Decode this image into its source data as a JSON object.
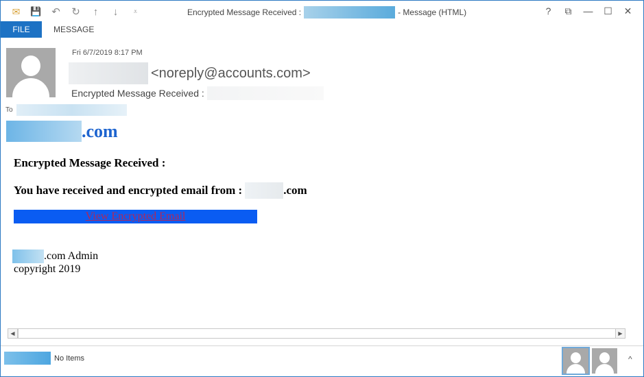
{
  "window": {
    "title_prefix": "Encrypted Message Received :",
    "title_suffix": "- Message (HTML)"
  },
  "qat_icons": [
    "mail-icon",
    "save-icon",
    "undo-icon",
    "redo-icon",
    "up-arrow-icon",
    "down-arrow-icon",
    "customize-qat-icon"
  ],
  "window_controls": {
    "help": "?",
    "restore_ribbon": "⧉",
    "minimize": "—",
    "maximize": "☐",
    "close": "✕"
  },
  "ribbon": {
    "tabs": [
      {
        "label": "FILE"
      },
      {
        "label": "MESSAGE"
      }
    ]
  },
  "header": {
    "date": "Fri 6/7/2019 8:17 PM",
    "from_email": "<noreply@accounts.com>",
    "subject": "Encrypted Message Received :",
    "to_label": "To"
  },
  "body": {
    "domain_suffix": ".com",
    "heading": "Encrypted Message Received :",
    "line_prefix": "You have received and encrypted email from :",
    "line_suffix": ".com",
    "cta_label": "View Encrypted Email",
    "admin_suffix": ".com Admin",
    "copyright": "copyright 2019"
  },
  "scrollbar": {
    "left_arrow": "◀",
    "right_arrow": "▶"
  },
  "people_pane": {
    "status": "No Items",
    "collapse": "^"
  },
  "colors": {
    "accent": "#1d72c4",
    "link_blue": "#1d64cf",
    "cta_bg": "#0a5cf2",
    "cta_text": "#b0285a"
  }
}
